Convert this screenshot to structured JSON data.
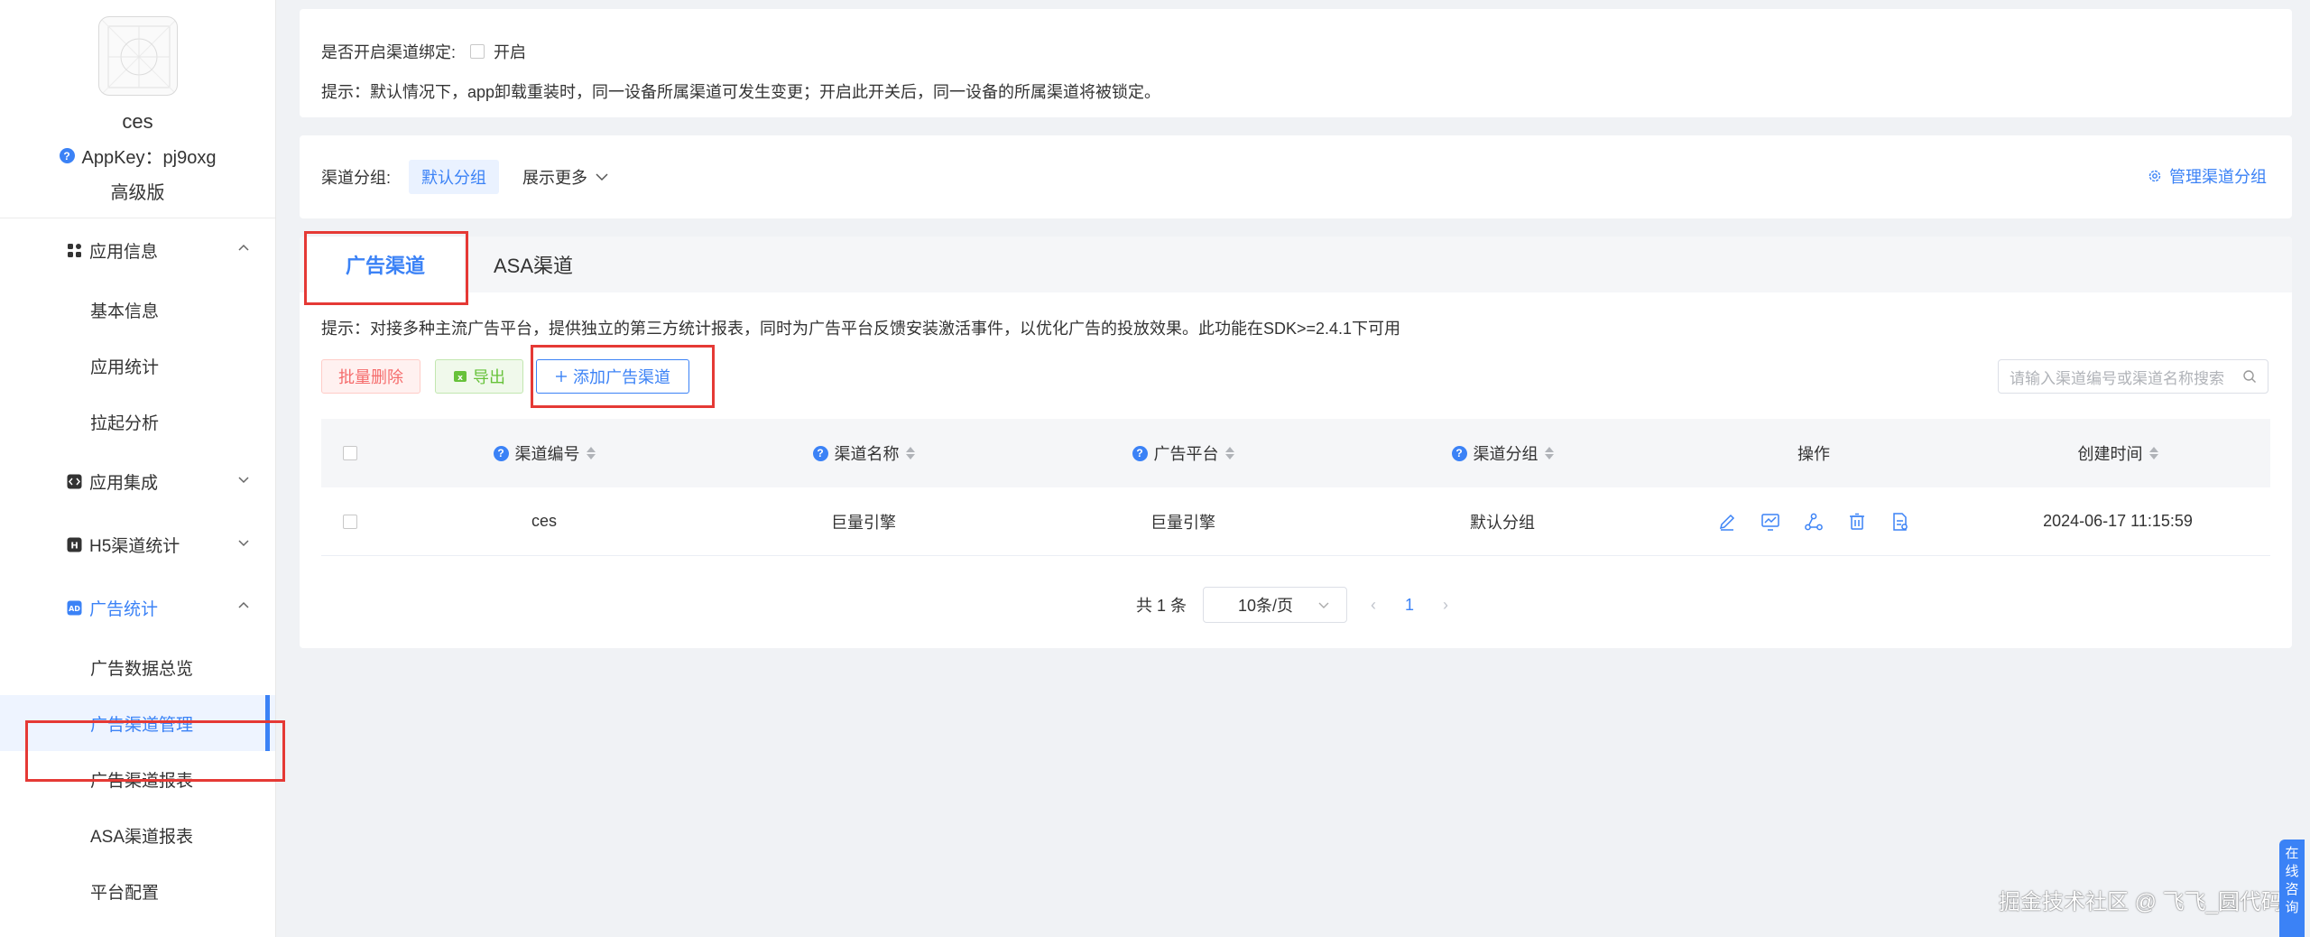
{
  "sidebar": {
    "app_name": "ces",
    "appkey": "AppKey：pj9oxg",
    "edition": "高级版",
    "groups": [
      {
        "label": "应用信息",
        "items": [
          "基本信息",
          "应用统计",
          "拉起分析"
        ]
      },
      {
        "label": "应用集成"
      },
      {
        "label": "H5渠道统计"
      },
      {
        "label": "广告统计",
        "items": [
          "广告数据总览",
          "广告渠道管理",
          "广告渠道报表",
          "ASA渠道报表",
          "平台配置"
        ]
      }
    ]
  },
  "binding": {
    "label": "是否开启渠道绑定:",
    "option": "开启",
    "hint": "提示：默认情况下，app卸载重装时，同一设备所属渠道可发生变更；开启此开关后，同一设备的所属渠道将被锁定。"
  },
  "group_bar": {
    "label": "渠道分组:",
    "tag": "默认分组",
    "more": "展示更多",
    "manage": "管理渠道分组"
  },
  "tabs": [
    "广告渠道",
    "ASA渠道"
  ],
  "tip": "提示：对接多种主流广告平台，提供独立的第三方统计报表，同时为广告平台反馈安装激活事件，以优化广告的投放效果。此功能在SDK>=2.4.1下可用",
  "toolbar": {
    "delete": "批量删除",
    "export": "导出",
    "add": "添加广告渠道",
    "search_placeholder": "请输入渠道编号或渠道名称搜索"
  },
  "table": {
    "headers": [
      "渠道编号",
      "渠道名称",
      "广告平台",
      "渠道分组",
      "操作",
      "创建时间"
    ],
    "rows": [
      [
        "ces",
        "巨量引擎",
        "巨量引擎",
        "默认分组",
        "",
        "2024-06-17 11:15:59"
      ]
    ]
  },
  "pagination": {
    "total": "共 1 条",
    "size": "10条/页",
    "current": "1"
  },
  "watermark": "掘金技术社区 @ 飞飞_圆代码",
  "consult": [
    "在",
    "线",
    "咨",
    "询"
  ],
  "colors": {
    "accent": "#3b82f6",
    "danger": "#f56c6c",
    "success": "#67c23a",
    "highlight": "#e53935"
  }
}
